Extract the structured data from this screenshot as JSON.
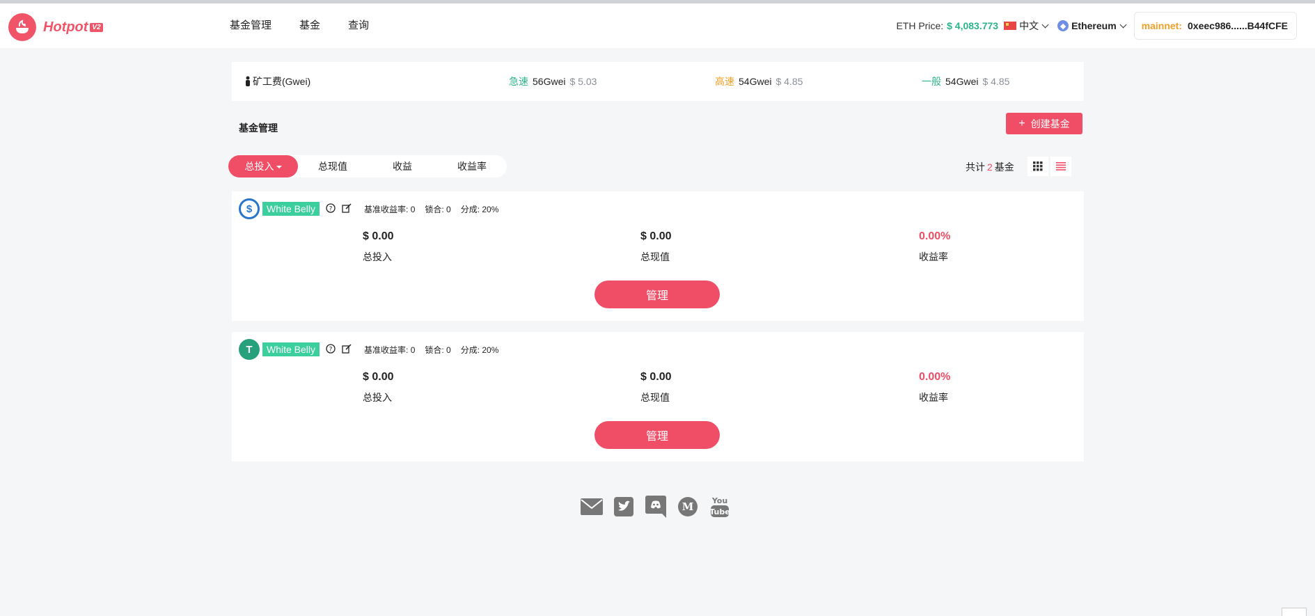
{
  "logo": {
    "text": "Hotpot",
    "badge": "V2"
  },
  "nav": {
    "items": [
      "基金管理",
      "基金",
      "查询"
    ]
  },
  "header": {
    "eth_price_label": "ETH Price:",
    "eth_price_value": "$ 4,083.773",
    "language": "中文",
    "network": "Ethereum",
    "account_network": "mainnet:",
    "account_address": "0xeec986......B44fCFE"
  },
  "gas": {
    "title": "矿工费(Gwei)",
    "fast": {
      "label": "急速",
      "gwei": "56Gwei",
      "usd": "$ 5.03"
    },
    "high": {
      "label": "高速",
      "gwei": "54Gwei",
      "usd": "$ 4.85"
    },
    "normal": {
      "label": "一般",
      "gwei": "54Gwei",
      "usd": "$ 4.85"
    }
  },
  "section": {
    "title": "基金管理",
    "create_button": "创建基金"
  },
  "sort": {
    "tabs": [
      "总投入",
      "总现值",
      "收益",
      "收益率"
    ]
  },
  "count": {
    "prefix": "共计",
    "value": "2",
    "suffix": "基金"
  },
  "funds": [
    {
      "coin": "usdc-icon",
      "name": "White Belly",
      "meta": {
        "benchmark": "基准收益率: 0",
        "lock": "锁合: 0",
        "split": "分成: 20%"
      },
      "total_invest": "$ 0.00",
      "total_invest_label": "总投入",
      "total_value": "$ 0.00",
      "total_value_label": "总现值",
      "yield": "0.00%",
      "yield_label": "收益率",
      "manage": "管理"
    },
    {
      "coin": "usdt-icon",
      "name": "White Belly",
      "meta": {
        "benchmark": "基准收益率: 0",
        "lock": "锁合: 0",
        "split": "分成: 20%"
      },
      "total_invest": "$ 0.00",
      "total_invest_label": "总投入",
      "total_value": "$ 0.00",
      "total_value_label": "总现值",
      "yield": "0.00%",
      "yield_label": "收益率",
      "manage": "管理"
    }
  ],
  "social": [
    "mail-icon",
    "twitter-icon",
    "discord-icon",
    "medium-icon",
    "youtube-icon"
  ],
  "colors": {
    "accent": "#f04d66",
    "green": "#2bb48a",
    "orange": "#f0a028"
  }
}
